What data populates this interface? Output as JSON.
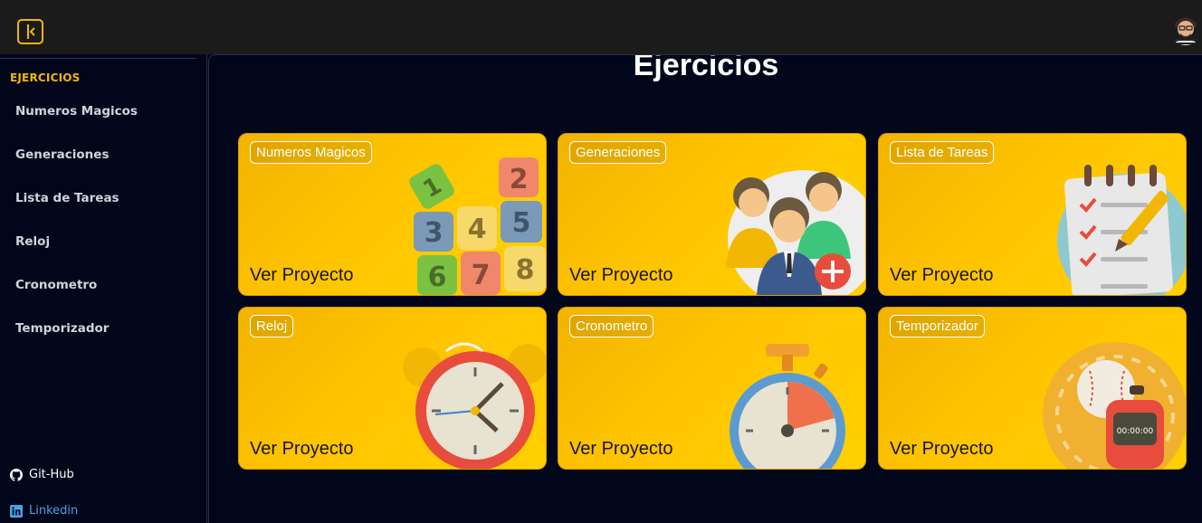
{
  "header": {
    "toggle_icon": "sidebar-toggle-icon",
    "avatar_icon": "user-avatar"
  },
  "sidebar": {
    "heading": "EJERCICIOS",
    "items": [
      {
        "label": "Numeros Magicos"
      },
      {
        "label": "Generaciones"
      },
      {
        "label": "Lista de Tareas"
      },
      {
        "label": "Reloj"
      },
      {
        "label": "Cronometro"
      },
      {
        "label": "Temporizador"
      }
    ],
    "links": [
      {
        "label": "Git-Hub",
        "icon": "github-icon"
      },
      {
        "label": "Linkedin",
        "icon": "linkedin-icon"
      }
    ]
  },
  "main": {
    "title": "Ejercicios",
    "cards": [
      {
        "tag": "Numeros Magicos",
        "cta": "Ver Proyecto"
      },
      {
        "tag": "Generaciones",
        "cta": "Ver Proyecto"
      },
      {
        "tag": "Lista de Tareas",
        "cta": "Ver Proyecto"
      },
      {
        "tag": "Reloj",
        "cta": "Ver Proyecto"
      },
      {
        "tag": "Cronometro",
        "cta": "Ver Proyecto"
      },
      {
        "tag": "Temporizador",
        "cta": "Ver Proyecto"
      }
    ],
    "timer_display": "00:00:00"
  },
  "colors": {
    "accent": "#f2b705",
    "background": "#02061a",
    "topbar": "#1b1b1b",
    "linkedin": "#4aa3e6"
  }
}
